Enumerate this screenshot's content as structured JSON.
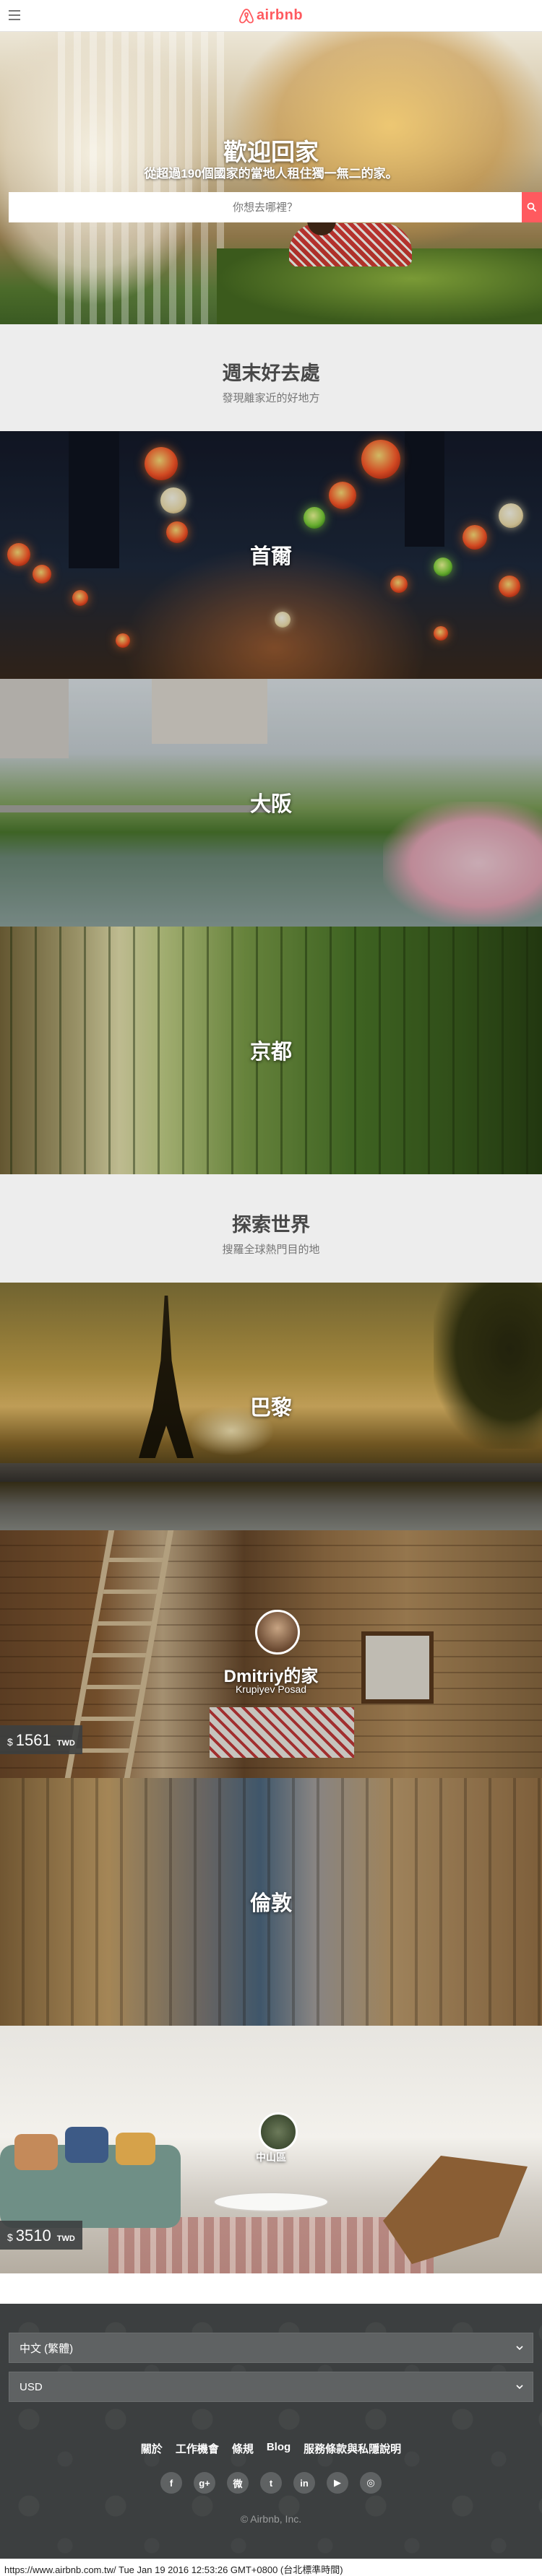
{
  "header": {
    "brand": "airbnb",
    "icons": {
      "menu": "hamburger-menu-icon",
      "logo": "airbnb-belo-icon"
    }
  },
  "hero": {
    "title": "歡迎回家",
    "subtitle": "從超過190個國家的當地人租住獨一無二的家。",
    "search_placeholder": "你想去哪裡？",
    "search_icon": "search-icon"
  },
  "weekend": {
    "title": "週末好去處",
    "subtitle": "發現離家近的好地方",
    "cities": [
      {
        "name": "首爾"
      },
      {
        "name": "大阪"
      },
      {
        "name": "京都"
      }
    ]
  },
  "explore": {
    "title": "探索世界",
    "subtitle": "搜羅全球熱門目的地",
    "cards": [
      {
        "type": "city",
        "name": "巴黎"
      },
      {
        "type": "listing",
        "title": "Dmitriy的家",
        "location": "Krupiyev Posad",
        "price_currency": "$",
        "price": "1561",
        "price_unit": "TWD"
      },
      {
        "type": "city",
        "name": "倫敦"
      },
      {
        "type": "listing",
        "title": "中山區",
        "price_currency": "$",
        "price": "3510",
        "price_unit": "TWD"
      }
    ]
  },
  "footer": {
    "language": "中文 (繁體)",
    "currency": "USD",
    "links": [
      "關於",
      "工作機會",
      "條規",
      "Blog",
      "服務條款與私隱說明"
    ],
    "social": [
      {
        "name": "facebook-icon",
        "glyph": "f"
      },
      {
        "name": "google-plus-icon",
        "glyph": "g+"
      },
      {
        "name": "weibo-icon",
        "glyph": "微"
      },
      {
        "name": "twitter-icon",
        "glyph": "t"
      },
      {
        "name": "linkedin-icon",
        "glyph": "in"
      },
      {
        "name": "youtube-icon",
        "glyph": "▶"
      },
      {
        "name": "instagram-icon",
        "glyph": "◎"
      }
    ],
    "copyright": "© Airbnb, Inc."
  },
  "capture_line": "https://www.airbnb.com.tw/ Tue Jan 19 2016 12:53:26 GMT+0800 (台北標準時間)",
  "colors": {
    "brand": "#ff5a5f",
    "footer_bg": "#3c3f40",
    "section_bg": "#ededed"
  }
}
